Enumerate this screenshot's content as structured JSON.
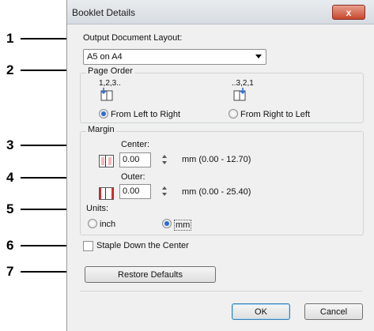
{
  "callouts": [
    "1",
    "2",
    "3",
    "4",
    "5",
    "6",
    "7"
  ],
  "dialog": {
    "title": "Booklet Details",
    "close_glyph": "x",
    "output_layout_label": "Output Document Layout:",
    "output_layout_value": "A5 on A4",
    "page_order": {
      "group_label": "Page Order",
      "ltr_caption": "1,2,3..",
      "rtl_caption": "..3,2,1",
      "ltr_label": "From Left to Right",
      "rtl_label": "From Right to Left",
      "selected": "ltr"
    },
    "margin": {
      "group_label": "Margin",
      "center_label": "Center:",
      "center_value": "0.00",
      "center_range": "mm (0.00 - 12.70)",
      "outer_label": "Outer:",
      "outer_value": "0.00",
      "outer_range": "mm (0.00 - 25.40)",
      "units_label": "Units:",
      "unit_inch": "inch",
      "unit_mm": "mm",
      "selected_unit": "mm"
    },
    "staple_label": "Staple Down the Center",
    "staple_checked": false,
    "restore_defaults_label": "Restore Defaults",
    "ok_label": "OK",
    "cancel_label": "Cancel"
  }
}
